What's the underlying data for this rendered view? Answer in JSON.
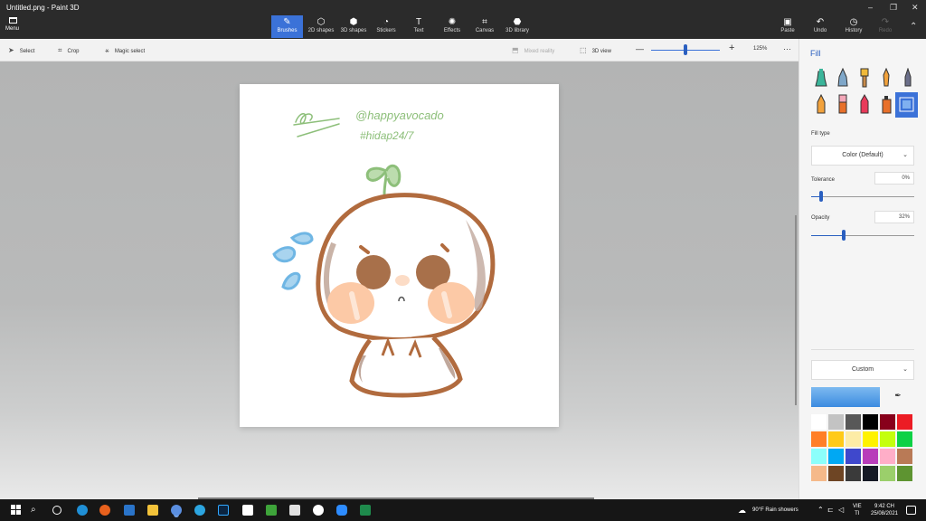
{
  "window": {
    "title": "Untitled.png - Paint 3D",
    "minimize": "–",
    "restore": "❐",
    "close": "✕"
  },
  "topbar": {
    "menu_label": "Menu",
    "tools": [
      {
        "label": "Brushes",
        "icon": "brush-icon",
        "glyph": "✎",
        "active": true
      },
      {
        "label": "2D shapes",
        "icon": "2d-shapes-icon",
        "glyph": "⬡"
      },
      {
        "label": "3D shapes",
        "icon": "3d-shapes-icon",
        "glyph": "⬢"
      },
      {
        "label": "Stickers",
        "icon": "sticker-icon",
        "glyph": "◔"
      },
      {
        "label": "Text",
        "icon": "text-icon",
        "glyph": "T"
      },
      {
        "label": "Effects",
        "icon": "effects-icon",
        "glyph": "✺"
      },
      {
        "label": "Canvas",
        "icon": "canvas-icon",
        "glyph": "⌗"
      },
      {
        "label": "3D library",
        "icon": "3d-library-icon",
        "glyph": "⬣"
      }
    ],
    "paste_label": "Paste",
    "undo_label": "Undo",
    "history_label": "History",
    "redo_label": "Redo"
  },
  "toolbar": {
    "select_label": "Select",
    "crop_label": "Crop",
    "magic_select_label": "Magic select",
    "mixed_reality_label": "Mixed reality",
    "view3d_label": "3D view",
    "zoom_minus": "—",
    "zoom_plus": "+",
    "zoom_value": "125%",
    "more": "···",
    "zoom_level_fraction": 0.5
  },
  "canvas": {
    "sketch_handle": "@happyavocado",
    "sketch_tag": "#hidap24/7"
  },
  "panel": {
    "title": "Fill",
    "brushes": [
      "marker",
      "calligraphy-pen",
      "oil-brush",
      "watercolor",
      "pixel-pen",
      "pencil",
      "eraser",
      "crayon",
      "spraycan",
      "fill"
    ],
    "fill_type_label": "Fill type",
    "fill_type_value": "Color (Default)",
    "tolerance_label": "Tolerance",
    "tolerance_value": "0%",
    "tolerance_fraction": 0.1,
    "opacity_label": "Opacity",
    "opacity_value": "32%",
    "opacity_fraction": 0.32,
    "palette_mode": "Custom",
    "current_color": "#3b8be0",
    "swatches": [
      "#ffffff",
      "#c3c3c3",
      "#585858",
      "#000000",
      "#88001b",
      "#ec1c24",
      "#ff7f27",
      "#ffca18",
      "#fdeca6",
      "#fff200",
      "#c4ff0e",
      "#0ed145",
      "#8cfffb",
      "#00a8f3",
      "#3f48cc",
      "#b83dba",
      "#ffaec8",
      "#b97a56",
      "#f5b98a",
      "#6e4524",
      "#3a3a3a",
      "#161a26",
      "#9bcf6b",
      "#5e9431"
    ]
  },
  "taskbar": {
    "weather": "90°F Rain showers",
    "lang_top": "VIE",
    "lang_bottom": "TI",
    "time": "9:42 CH",
    "date": "25/08/2021"
  }
}
